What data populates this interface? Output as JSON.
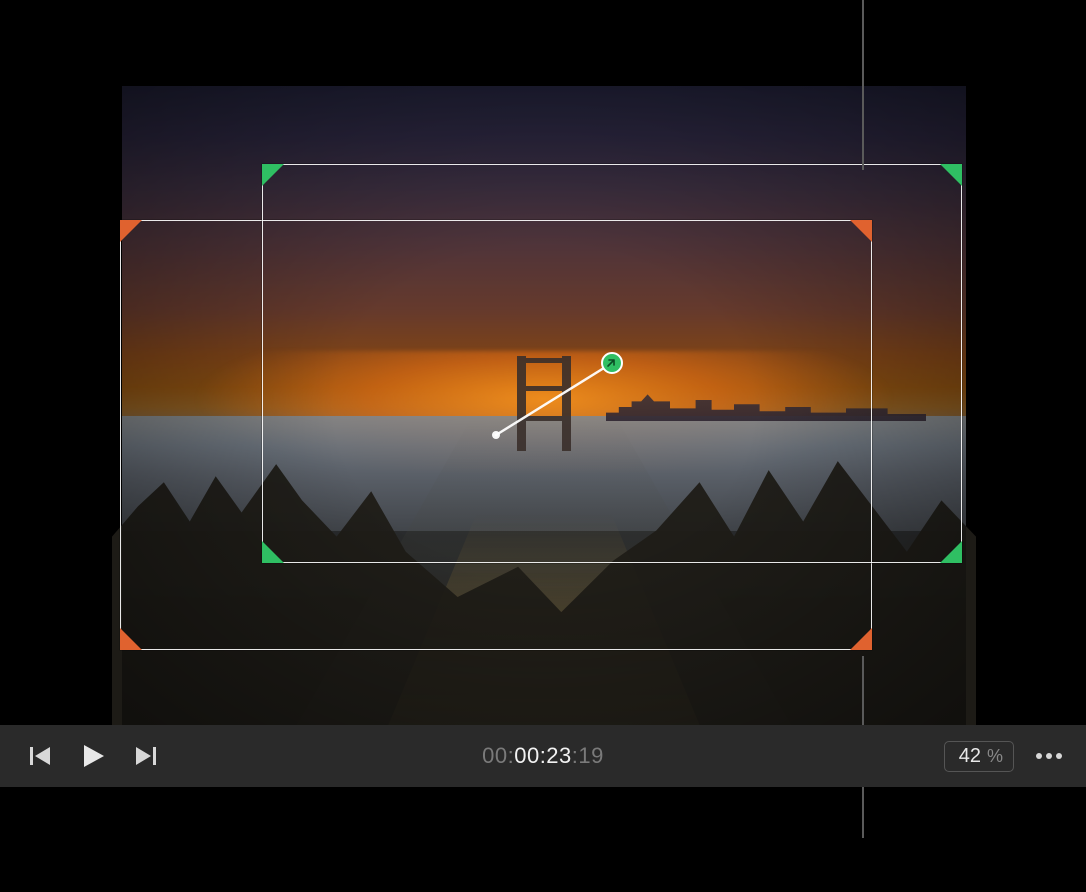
{
  "viewer": {
    "kenburns": {
      "start_corner_color": "#e0622f",
      "end_corner_color": "#2fbf63",
      "arrow_head_color": "#2fbf63"
    }
  },
  "toolbar": {
    "timecode": {
      "dim_prefix": "00:",
      "main": "00:23",
      "dim_suffix": ":19",
      "raw": "00:00:23:19"
    },
    "zoom": {
      "value": "42",
      "unit": "%"
    },
    "icons": {
      "prev": "previous-frame-icon",
      "play": "play-icon",
      "next": "next-frame-icon",
      "more": "more-options-icon"
    }
  }
}
